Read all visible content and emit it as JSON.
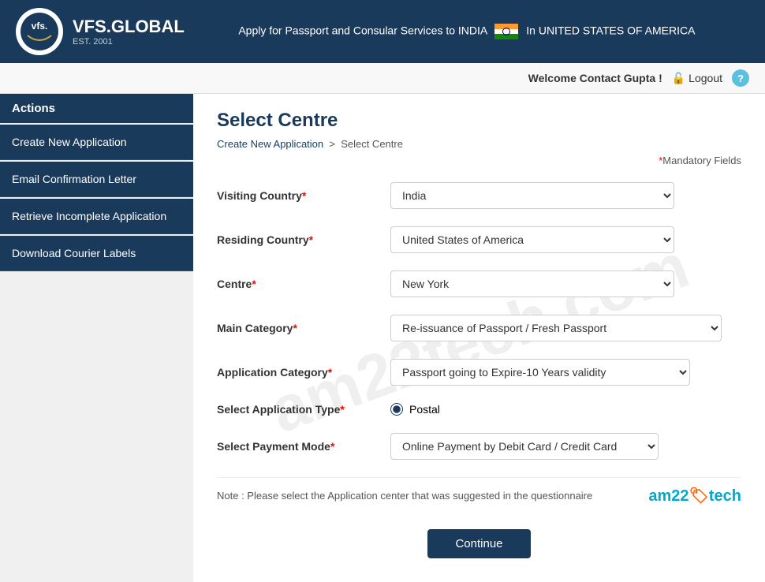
{
  "header": {
    "logo_brand": "VFS.GLOBAL",
    "logo_est": "EST. 2001",
    "tagline": "Apply for Passport and Consular Services to INDIA",
    "country": "In UNITED STATES OF AMERICA"
  },
  "subheader": {
    "welcome": "Welcome Contact Gupta !",
    "logout_label": "Logout",
    "help_label": "?"
  },
  "sidebar": {
    "header": "Actions",
    "items": [
      {
        "label": "Create New Application"
      },
      {
        "label": "Email Confirmation Letter"
      },
      {
        "label": "Retrieve Incomplete Application"
      },
      {
        "label": "Download Courier Labels"
      }
    ]
  },
  "page": {
    "title": "Select Centre",
    "breadcrumb_link": "Create New Application",
    "breadcrumb_current": "Select Centre",
    "mandatory_note": "Mandatory Fields"
  },
  "form": {
    "visiting_country_label": "Visiting Country",
    "visiting_country_value": "India",
    "residing_country_label": "Residing Country",
    "residing_country_value": "United States of America",
    "centre_label": "Centre",
    "centre_value": "New York",
    "main_category_label": "Main Category",
    "main_category_value": "Re-issuance of Passport / Fresh Passport",
    "app_category_label": "Application Category",
    "app_category_value": "Passport going to Expire-10 Years validity",
    "app_type_label": "Select Application Type",
    "app_type_value": "Postal",
    "payment_mode_label": "Select Payment Mode",
    "payment_mode_value": "Online Payment by Debit Card / Credit Card"
  },
  "note": {
    "text": "Note : Please select the Application center that was suggested in the questionnaire"
  },
  "footer": {
    "continue_label": "Continue"
  },
  "watermark": "am22tech.com"
}
